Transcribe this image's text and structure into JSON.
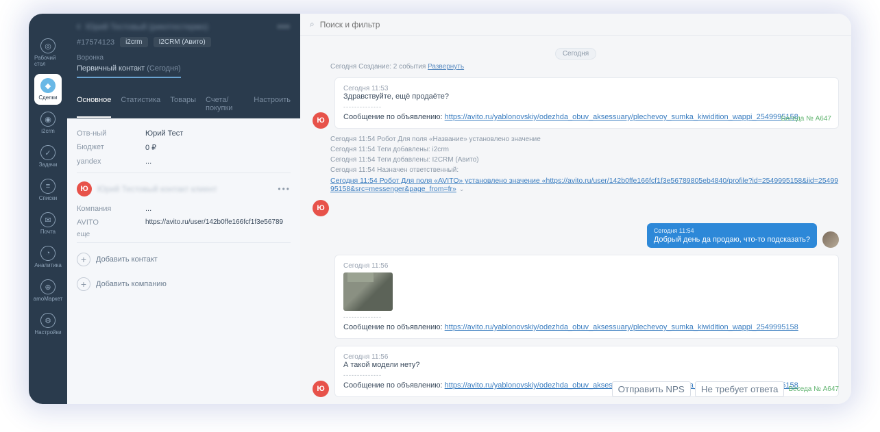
{
  "nav": [
    {
      "key": "desktop",
      "label": "Рабочий стол"
    },
    {
      "key": "deals",
      "label": "Сделки"
    },
    {
      "key": "i2crm",
      "label": "i2crm"
    },
    {
      "key": "tasks",
      "label": "Задачи"
    },
    {
      "key": "lists",
      "label": "Списки"
    },
    {
      "key": "mail",
      "label": "Почта"
    },
    {
      "key": "analytics",
      "label": "Аналитика"
    },
    {
      "key": "amomarket",
      "label": "amoМаркет"
    },
    {
      "key": "settings",
      "label": "Настройки"
    }
  ],
  "deal": {
    "title_blurred": "Юрий Тестовый (риелтестермо)",
    "id": "#17574123",
    "tags": [
      "i2crm",
      "I2CRM (Авито)"
    ],
    "funnel_label": "Воронка",
    "stage": "Первичный контакт",
    "stage_when": "(Сегодня)",
    "tabs": [
      "Основное",
      "Статистика",
      "Товары",
      "Счета/покупки",
      "Настроить"
    ],
    "fields": [
      {
        "label": "Отв-ный",
        "value": "Юрий Тест"
      },
      {
        "label": "Бюджет",
        "value": "0 ₽"
      },
      {
        "label": "yandex",
        "value": "..."
      }
    ],
    "contact_initial": "Ю",
    "company_label": "Компания",
    "company_value": "...",
    "avito_label": "AVITO",
    "avito_value": "https://avito.ru/user/142b0ffe166fcf1f3e56789",
    "more_label": "еще",
    "add_contact": "Добавить контакт",
    "add_company": "Добавить компанию"
  },
  "search": {
    "placeholder": "Поиск и фильтр"
  },
  "feed": {
    "day": "Сегодня",
    "creation_line": "Сегодня Создание: 2 события",
    "expand": "Развернуть",
    "msg1": {
      "time": "Сегодня 11:53",
      "greeting": "Здравствуйте, ещё продаёте?",
      "divider": "--------------",
      "adline": "Сообщение по объявлению:",
      "link": "https://avito.ru/yablonovskiy/odezhda_obuv_aksessuary/plechevoy_sumka_kiwidition_wappi_2549995158",
      "convo": "Беседа № А647"
    },
    "robot": [
      "Сегодня 11:54 Робот Для поля «Название» установлено значение",
      "Сегодня 11:54            Теги добавлены: i2crm",
      "Сегодня 11:54            Теги добавлены: I2CRM (Авито)",
      "Сегодня 11:54            Назначен ответственный:",
      "Сегодня 11:54 Робот Для поля «AVITO» установлено значение «https://avito.ru/user/142b0ffe166fcf1f3e56789805eb4840/profile?id=2549995158&iid=2549995158&src=messenger&page_from=fr»"
    ],
    "reply": {
      "time": "Сегодня 11:54",
      "text": "Добрый день да продаю, что-то подсказать?"
    },
    "msg2": {
      "time": "Сегодня 11:56",
      "divider": "--------------",
      "adline": "Сообщение по объявлению:",
      "link": "https://avito.ru/yablonovskiy/odezhda_obuv_aksessuary/plechevoy_sumka_kiwidition_wappi_2549995158"
    },
    "msg3": {
      "time": "Сегодня 11:56",
      "text": "А такой модели нету?",
      "divider": "--------------",
      "adline": "Сообщение по объявлению:",
      "link": "https://avito.ru/yablonovskiy/odezhda_obuv_aksessuary/plechevoy_sumka_kiwidition_wappi_2549995158"
    },
    "footer": {
      "nps": "Отправить NPS",
      "noreply": "Не требует ответа",
      "convo": "Беседа № А647"
    }
  }
}
